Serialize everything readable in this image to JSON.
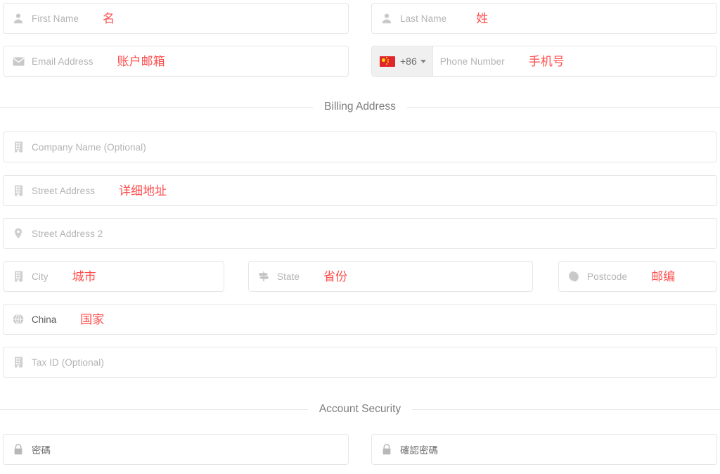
{
  "form": {
    "personal": {
      "first_name": {
        "placeholder": "First Name",
        "annotation": "名",
        "icon": "user-icon"
      },
      "last_name": {
        "placeholder": "Last Name",
        "annotation": "姓",
        "icon": "user-icon"
      },
      "email": {
        "placeholder": "Email Address",
        "annotation": "账户邮箱",
        "icon": "envelope-icon"
      },
      "phone": {
        "placeholder": "Phone Number",
        "annotation": "手机号",
        "dial_code": "+86",
        "flag": "china-flag-icon",
        "icon": "chevron-down-icon"
      }
    },
    "billing_section": {
      "title": "Billing Address"
    },
    "billing": {
      "company": {
        "placeholder": "Company Name (Optional)",
        "annotation": "",
        "icon": "building-icon"
      },
      "street1": {
        "placeholder": "Street Address",
        "annotation": "详细地址",
        "icon": "building-icon"
      },
      "street2": {
        "placeholder": "Street Address 2",
        "annotation": "",
        "icon": "map-pin-icon"
      },
      "city": {
        "placeholder": "City",
        "annotation": "城市",
        "icon": "building-icon"
      },
      "state": {
        "placeholder": "State",
        "annotation": "省份",
        "icon": "signpost-icon"
      },
      "postcode": {
        "placeholder": "Postcode",
        "annotation": "邮编",
        "icon": "starburst-icon"
      },
      "country": {
        "value": "China",
        "annotation": "国家",
        "icon": "globe-icon"
      },
      "tax_id": {
        "placeholder": "Tax ID (Optional)",
        "annotation": "",
        "icon": "building-icon"
      }
    },
    "security_section": {
      "title": "Account Security"
    },
    "security": {
      "password": {
        "placeholder": "密碼",
        "icon": "lock-icon"
      },
      "confirm_password": {
        "placeholder": "確認密碼",
        "icon": "lock-icon"
      }
    }
  },
  "colors": {
    "annotation_red": "#ff4d4d",
    "placeholder_gray": "#b3b3b3",
    "border_gray": "#e6e6e6",
    "flag_red": "#e0262b",
    "flag_yellow": "#ffd900",
    "section_title_gray": "#7d7d7d"
  }
}
